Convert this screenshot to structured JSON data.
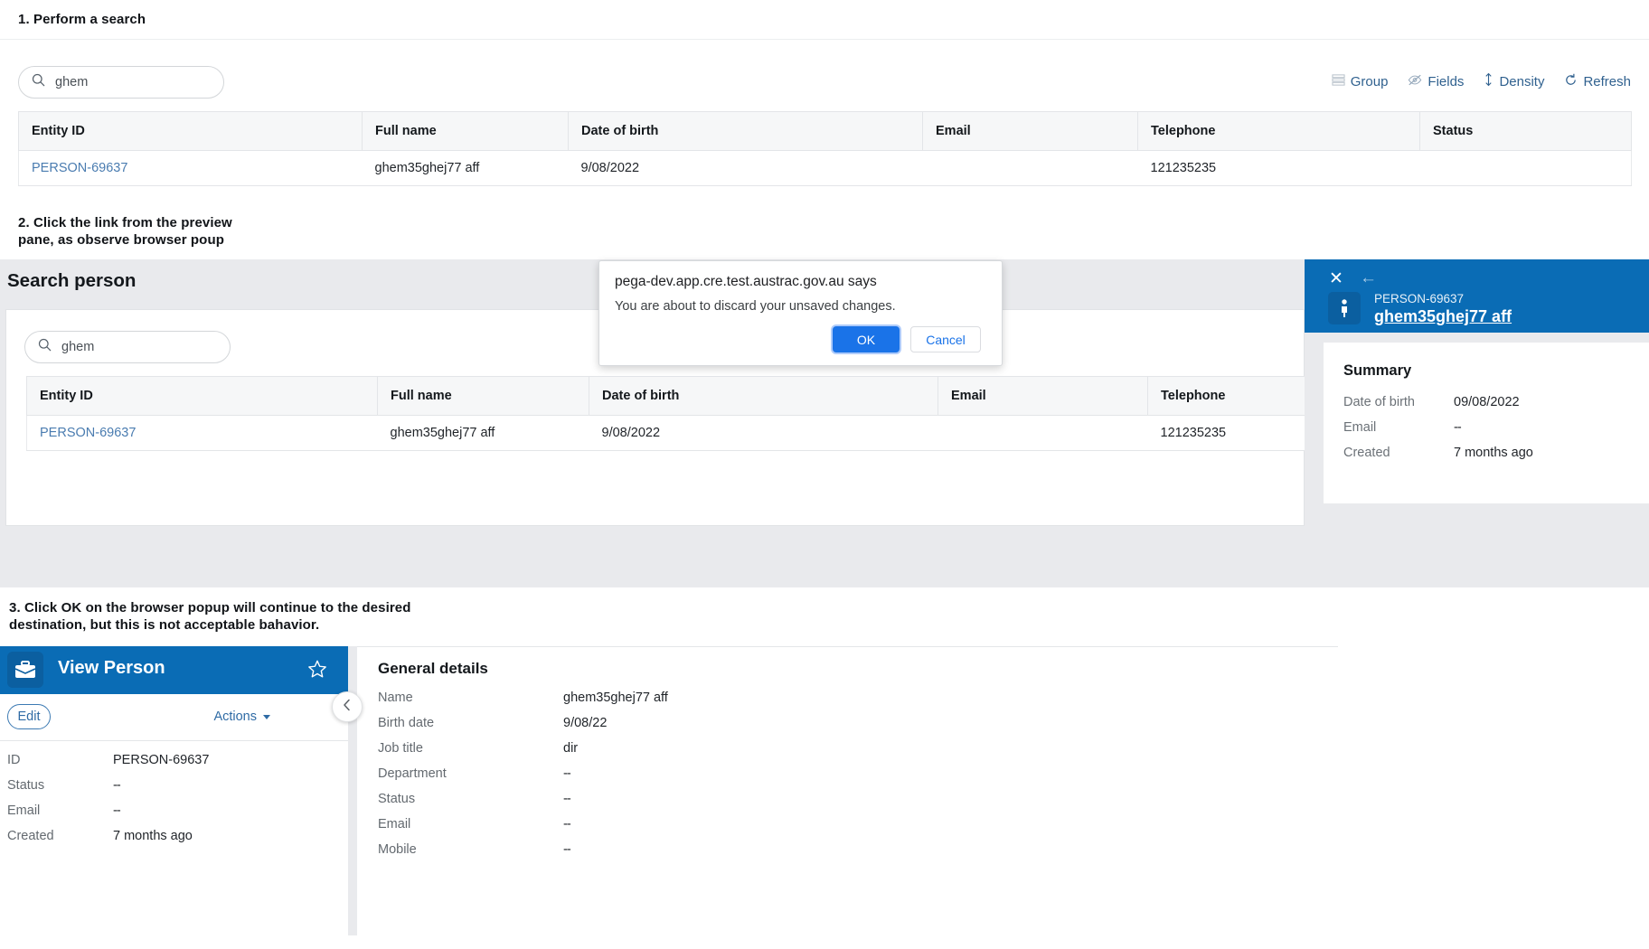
{
  "captions": {
    "step1": "1. Perform a search",
    "step2_line1": "2. Click the link from the preview",
    "step2_line2": "pane, as observe browser poup",
    "step3_line1": "3. Click OK on the browser popup will continue to the desired",
    "step3_line2": "destination, but this is not acceptable bahavior."
  },
  "search": {
    "value": "ghem",
    "placeholder": "Search",
    "icon": "search-icon"
  },
  "gridtools": [
    {
      "label": "Group",
      "icon": "group-rows-icon"
    },
    {
      "label": "Fields",
      "icon": "eye-slash-icon"
    },
    {
      "label": "Density",
      "icon": "density-arrows-icon"
    },
    {
      "label": "Refresh",
      "icon": "refresh-icon"
    }
  ],
  "table": {
    "columns": [
      "Entity ID",
      "Full name",
      "Date of birth",
      "Email",
      "Telephone",
      "Status"
    ],
    "rows": [
      {
        "entity_id": "PERSON-69637",
        "full_name": "ghem35ghej77 aff",
        "dob": "9/08/2022",
        "email": "",
        "telephone": "121235235",
        "status": ""
      }
    ]
  },
  "section2": {
    "title": "Search person"
  },
  "dialog": {
    "origin": "pega-dev.app.cre.test.austrac.gov.au says",
    "message": "You are about to discard your unsaved changes.",
    "ok_label": "OK",
    "cancel_label": "Cancel"
  },
  "preview": {
    "close_icon": "close-icon",
    "back_icon": "arrow-left-icon",
    "avatar_icon": "person-icon",
    "entity_id": "PERSON-69637",
    "name": "ghem35ghej77 aff",
    "summary_title": "Summary",
    "fields": [
      {
        "label": "Date of birth",
        "value": "09/08/2022"
      },
      {
        "label": "Email",
        "value": "--"
      },
      {
        "label": "Created",
        "value": "7 months ago"
      }
    ]
  },
  "view_person": {
    "title": "View Person",
    "icon": "briefcase-icon",
    "star_icon": "star-outline-icon",
    "edit_label": "Edit",
    "actions_label": "Actions",
    "collapse_icon": "chevron-left-icon",
    "fields": [
      {
        "label": "ID",
        "value": "PERSON-69637"
      },
      {
        "label": "Status",
        "value": "--"
      },
      {
        "label": "Email",
        "value": "--"
      },
      {
        "label": "Created",
        "value": "7 months ago"
      }
    ]
  },
  "general_details": {
    "title": "General details",
    "fields": [
      {
        "label": "Name",
        "value": "ghem35ghej77 aff"
      },
      {
        "label": "Birth date",
        "value": "9/08/22"
      },
      {
        "label": "Job title",
        "value": "dir"
      },
      {
        "label": "Department",
        "value": "--"
      },
      {
        "label": "Status",
        "value": "--"
      },
      {
        "label": "Email",
        "value": "--"
      },
      {
        "label": "Mobile",
        "value": "--"
      }
    ]
  },
  "colors": {
    "brand_blue": "#0a6cb5",
    "link_blue": "#4a7cb0",
    "tool_blue": "#30618f",
    "dialog_blue": "#1a73e8",
    "panel_gray": "#e9eaed"
  }
}
